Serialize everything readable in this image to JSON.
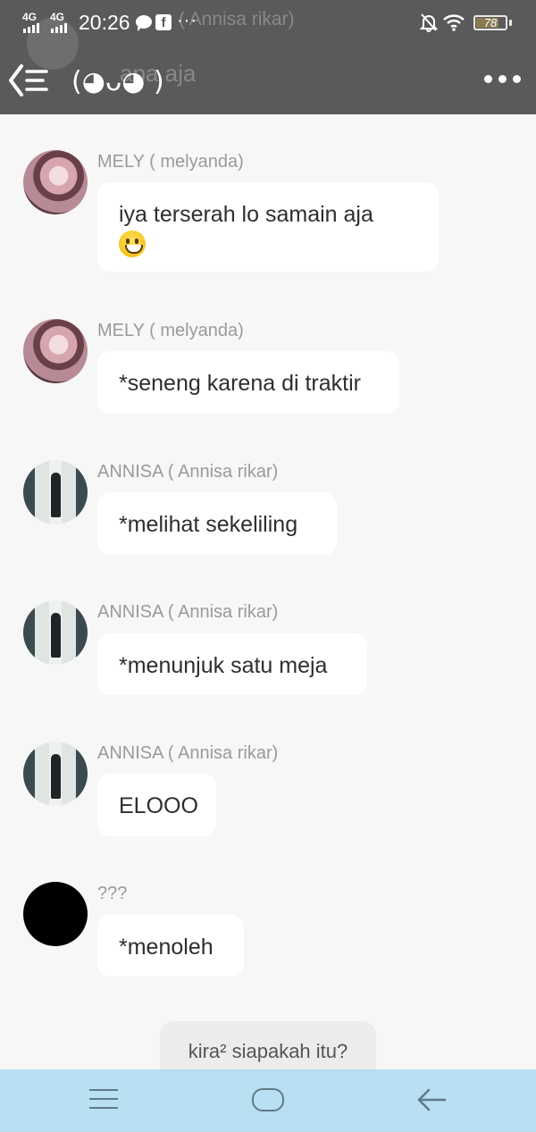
{
  "status_bar": {
    "signal_1": "4G",
    "signal_2": "4G",
    "time": "20:26",
    "more": "···",
    "battery": "78",
    "battery_fraction": 0.78
  },
  "header": {
    "title": "(◕ᴗ◕ )",
    "ghost_name": "( Annisa rikar)",
    "ghost_text": "apa aja",
    "icons": {
      "back": "back-list-icon",
      "menu": "more-dots-icon"
    },
    "bg_color": "#5a5a5a"
  },
  "messages": [
    {
      "sender": "MELY ( melyanda)",
      "text": "iya terserah lo samain aja",
      "emoji": "grinning-face",
      "avatar": "mely"
    },
    {
      "sender": "MELY ( melyanda)",
      "text": "*seneng karena di traktir",
      "avatar": "mely"
    },
    {
      "sender": "ANNISA ( Annisa rikar)",
      "text": "*melihat sekeliling",
      "avatar": "annisa"
    },
    {
      "sender": "ANNISA ( Annisa rikar)",
      "text": "*menunjuk satu meja",
      "avatar": "annisa"
    },
    {
      "sender": "ANNISA ( Annisa rikar)",
      "text": "ELOOO",
      "avatar": "annisa"
    },
    {
      "sender": "???",
      "text": "*menoleh",
      "avatar": "unknown"
    }
  ],
  "system_note": "kira² siapakah itu?",
  "navbar": {
    "icons": [
      "menu-icon",
      "home-icon",
      "back-arrow-icon"
    ],
    "bg_color": "#b8dff2"
  }
}
